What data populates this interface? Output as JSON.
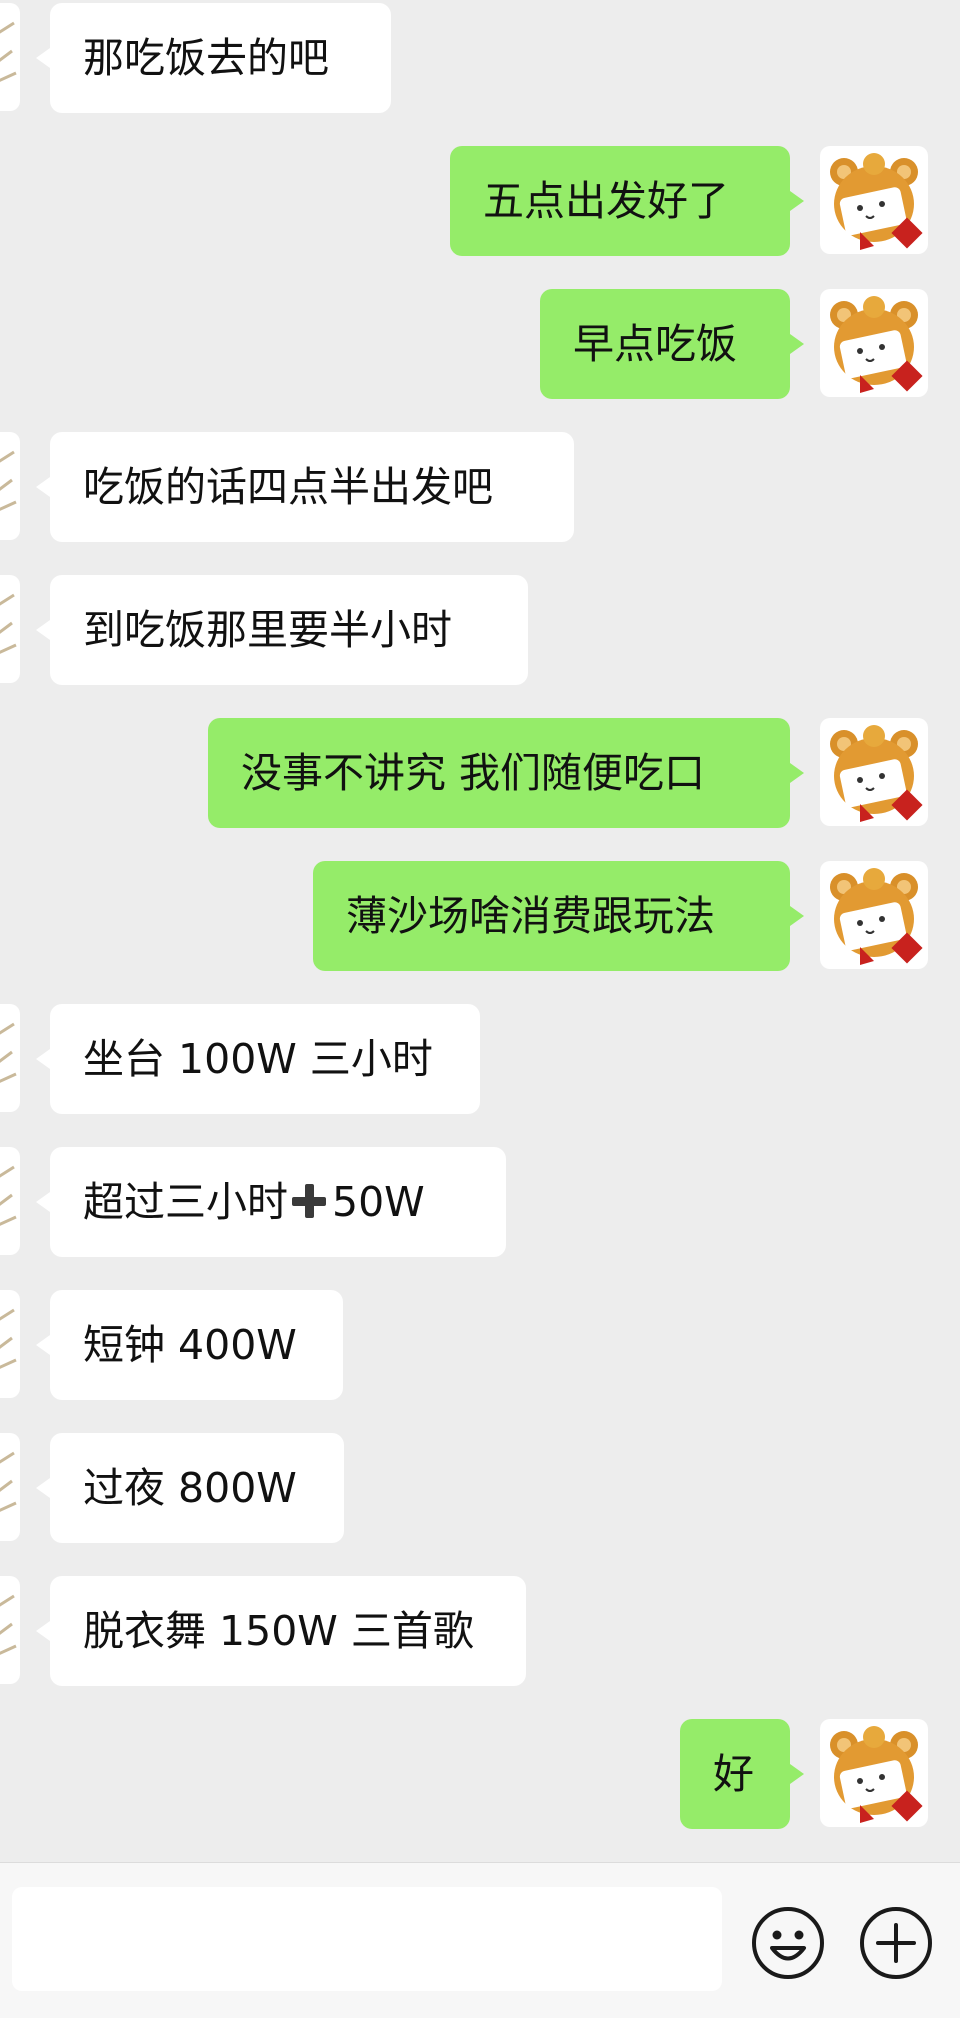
{
  "messages": [
    {
      "dir": "in",
      "text": "那吃饭去的吧"
    },
    {
      "dir": "out",
      "text": "五点出发好了"
    },
    {
      "dir": "out",
      "text": "早点吃饭"
    },
    {
      "dir": "in",
      "text": "吃饭的话四点半出发吧"
    },
    {
      "dir": "in",
      "text": "到吃饭那里要半小时"
    },
    {
      "dir": "out",
      "text": "没事不讲究 我们随便吃口"
    },
    {
      "dir": "out",
      "text": "薄沙场啥消费跟玩法"
    },
    {
      "dir": "in",
      "text": "坐台 100W 三小时"
    },
    {
      "dir": "in",
      "text_before": "超过三小时",
      "text_after": "50W",
      "icon": "heavy-plus-icon"
    },
    {
      "dir": "in",
      "text": "短钟 400W"
    },
    {
      "dir": "in",
      "text": "过夜 800W"
    },
    {
      "dir": "in",
      "text": "脱衣舞 150W 三首歌"
    },
    {
      "dir": "out",
      "text": "好"
    }
  ],
  "input_bar": {
    "text_value": "",
    "emoji_icon": "smiley-face-icon",
    "more_icon": "circle-plus-icon"
  },
  "colors": {
    "background": "#ededed",
    "incoming_bubble": "#ffffff",
    "outgoing_bubble": "#95ec69",
    "text": "#111111"
  }
}
